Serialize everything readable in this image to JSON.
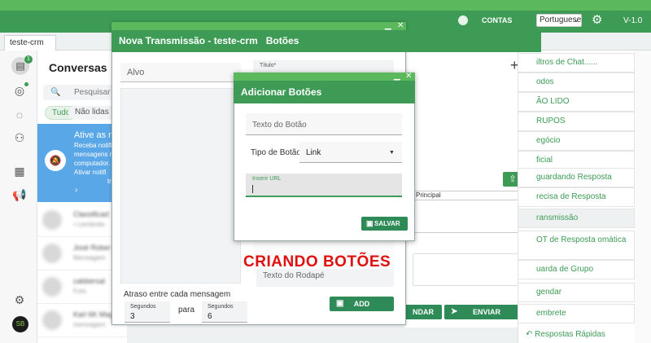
{
  "topbar": {
    "contas": "CONTAS",
    "language": "Portuguese",
    "version": "V-1.0"
  },
  "tabs": [
    {
      "label": "teste-crm"
    }
  ],
  "rail": {
    "badge": "1"
  },
  "conversations": {
    "title": "Conversas",
    "search_placeholder": "Pesquisar",
    "filters": [
      "Tudo",
      "Não lidas"
    ],
    "notification": {
      "title": "Ative as no",
      "lines": [
        "Receba notifi",
        "mensagens n",
        "computador.",
        "Ativar notifi",
        "tr"
      ]
    },
    "rows": [
      {
        "name": "Classificad",
        "sub": "• Lembrete"
      },
      {
        "name": "José Rober",
        "sub": "Mensagem"
      },
      {
        "name": "cabbersal",
        "sub": "Foto"
      },
      {
        "name": "Karl 6K Mag",
        "sub": "mensagem"
      }
    ]
  },
  "window": {
    "title": "Nova Transmissão - teste-crm",
    "tab_label": "Botões",
    "alvo_placeholder": "Alvo",
    "titulo_label": "Título*",
    "delay_label": "Atraso entre cada mensagem",
    "delay_from": {
      "label": "Segundos",
      "value": "3"
    },
    "para": "para",
    "delay_to": {
      "label": "Segundos",
      "value": "6"
    },
    "rodape_placeholder": "Texto do Rodapé",
    "add_label": "ADD"
  },
  "dialog": {
    "title": "Adicionar Botões",
    "texto_placeholder": "Texto do Botão",
    "tipo_label": "Tipo de Botão",
    "tipo_value": "Link",
    "url_label": "Inserir URL",
    "salvar_label": "SALVAR"
  },
  "editor": {
    "table_header": "Principal",
    "agendar_label": "NDAR",
    "enviar_label": "ENVIAR"
  },
  "filter_menu": {
    "items": [
      {
        "label": "iltros de Chat......"
      },
      {
        "label": "odos"
      },
      {
        "label": "ÃO LIDO"
      },
      {
        "label": "RUPOS"
      },
      {
        "label": "egócio"
      },
      {
        "label": "ficial"
      },
      {
        "label": "guardando Resposta"
      },
      {
        "label": "recisa de Resposta"
      },
      {
        "label": "ransmissão"
      },
      {
        "label": "OT de Resposta omática"
      },
      {
        "label": "uarda de Grupo"
      },
      {
        "label": "gendar"
      },
      {
        "label": "embrete"
      }
    ],
    "last": "Respostas Rápidas"
  },
  "caption": "CRIANDO BOTÕES",
  "colors": {
    "brand_green": "#3d9b55",
    "light_green": "#5cb85c",
    "notice_blue": "#5aa7e8",
    "caption_red": "#e01010"
  }
}
